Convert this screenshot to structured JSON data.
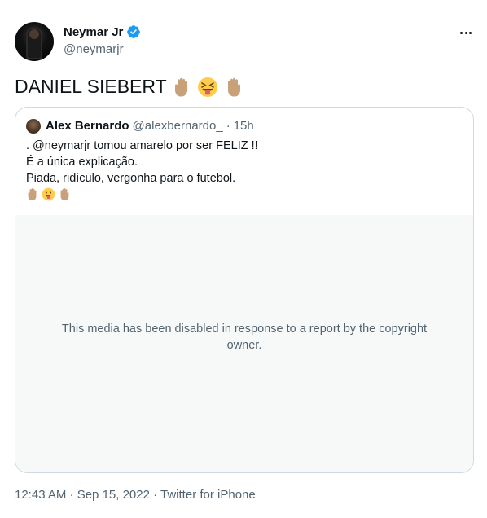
{
  "author": {
    "display_name": "Neymar Jr",
    "handle": "@neymarjr",
    "verified": true,
    "avatar_icon": "profile-photo"
  },
  "more_icon": "more-horizontal-icon",
  "tweet_text": "DANIEL SIEBERT",
  "tweet_emojis": [
    "raised-hand-icon",
    "squinting-tongue-face-icon",
    "raised-hand-icon"
  ],
  "quote": {
    "display_name": "Alex Bernardo",
    "handle": "@alexbernardo_",
    "separator": "·",
    "time": "15h",
    "lines": [
      ". @neymarjr tomou amarelo por ser FELIZ !!",
      "É a única explicação.",
      "Piada, ridículo, vergonha para o futebol."
    ],
    "emojis": [
      "raised-hand-icon",
      "tongue-face-icon",
      "raised-hand-icon"
    ],
    "media_notice": "This media has been disabled in response to a report by the copyright owner."
  },
  "meta": {
    "text": "12:43 AM · Sep 15, 2022 · Twitter for iPhone"
  },
  "colors": {
    "text": "#0f1419",
    "secondary": "#536471",
    "border": "#cfd9de",
    "verified": "#1d9bf0",
    "media_bg": "#f7f9f9"
  }
}
